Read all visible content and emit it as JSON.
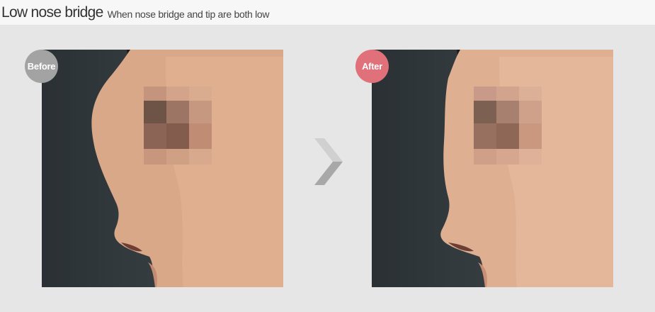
{
  "header": {
    "title": "Low nose bridge",
    "subtitle": "When nose bridge and tip are both low"
  },
  "comparison": {
    "before_label": "Before",
    "after_label": "After",
    "arrow_icon": "chevron-right-icon"
  },
  "colors": {
    "before_badge": "#a3a3a3",
    "after_badge": "#e0707a",
    "header_bg": "#f7f7f7",
    "page_bg": "#e6e6e6"
  }
}
